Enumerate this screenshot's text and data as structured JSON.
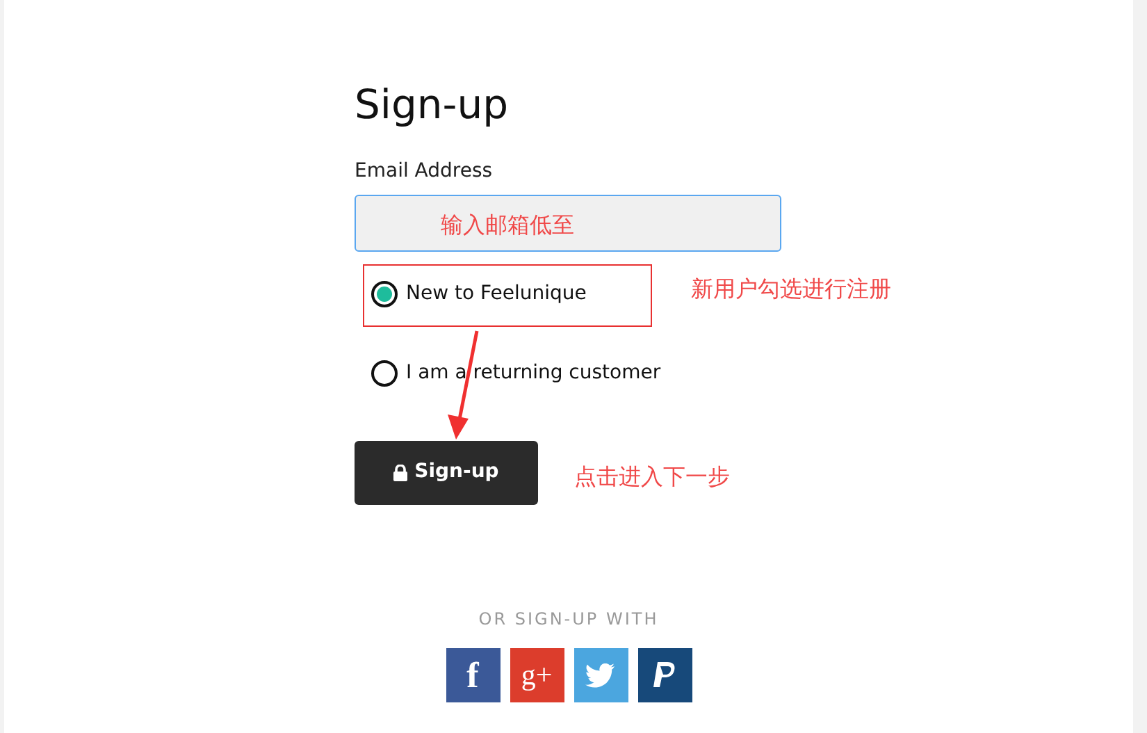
{
  "title": "Sign-up",
  "email": {
    "label": "Email Address",
    "annotation": "输入邮箱低至"
  },
  "options": [
    {
      "label": "New to Feelunique",
      "selected": true,
      "annotation": "新用户勾选进行注册"
    },
    {
      "label": "I am a returning customer",
      "selected": false
    }
  ],
  "submit": {
    "label": "Sign-up",
    "annotation": "点击进入下一步"
  },
  "social": {
    "heading": "OR SIGN-UP WITH",
    "buttons": [
      {
        "kind": "facebook",
        "glyph": "f"
      },
      {
        "kind": "google",
        "glyph": "g+"
      },
      {
        "kind": "twitter"
      },
      {
        "kind": "paypal"
      }
    ]
  }
}
